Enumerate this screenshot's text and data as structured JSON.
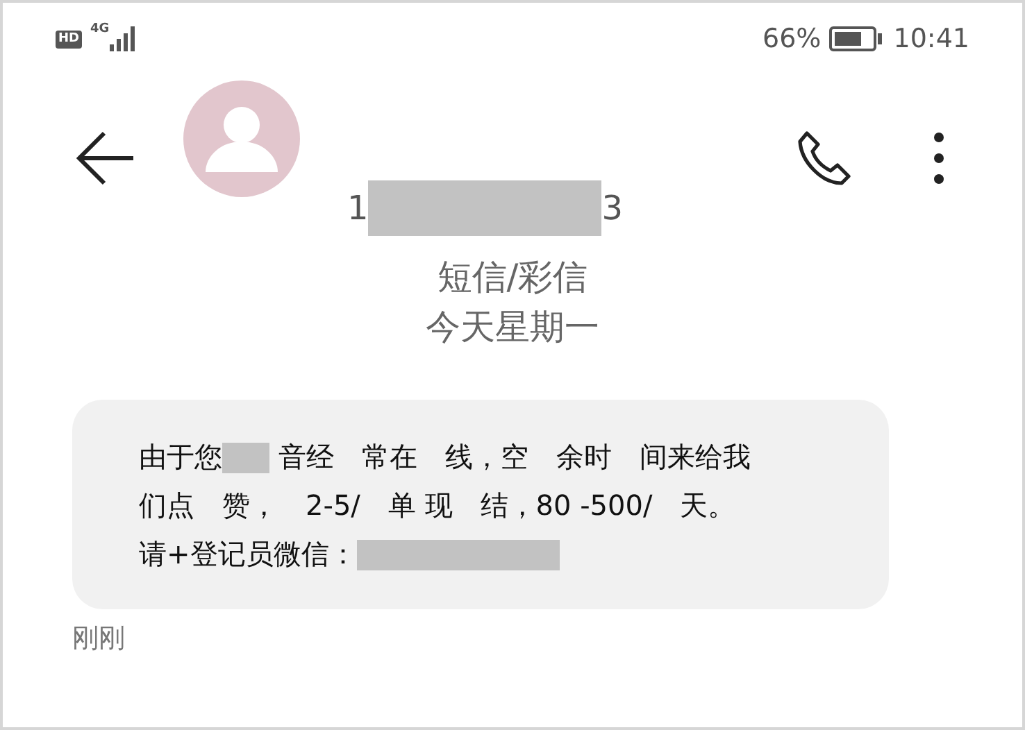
{
  "status_bar": {
    "hd": "HD",
    "battery": "66%",
    "time": "10:41",
    "network": "4G"
  },
  "header": {
    "contact": [
      {
        "kind": "text",
        "text": "1"
      },
      {
        "kind": "redacted"
      },
      {
        "kind": "text",
        "text": "3"
      }
    ]
  },
  "thread_info": {
    "channel": "短信/彩信",
    "date": "今天星期一"
  },
  "message": {
    "lines": [
      [
        {
          "kind": "text",
          "text": "由于您"
        },
        {
          "kind": "redacted"
        },
        {
          "kind": "text",
          "text": " 音经　常在　线，空　余时　间来给我"
        }
      ],
      [
        {
          "kind": "text",
          "text": "们点　赞，　2-5/　单 现　结，80 -500/　天。"
        }
      ],
      [
        {
          "kind": "text",
          "text": "请+登记员微信："
        },
        {
          "kind": "redacted"
        }
      ]
    ],
    "time": "刚刚"
  }
}
